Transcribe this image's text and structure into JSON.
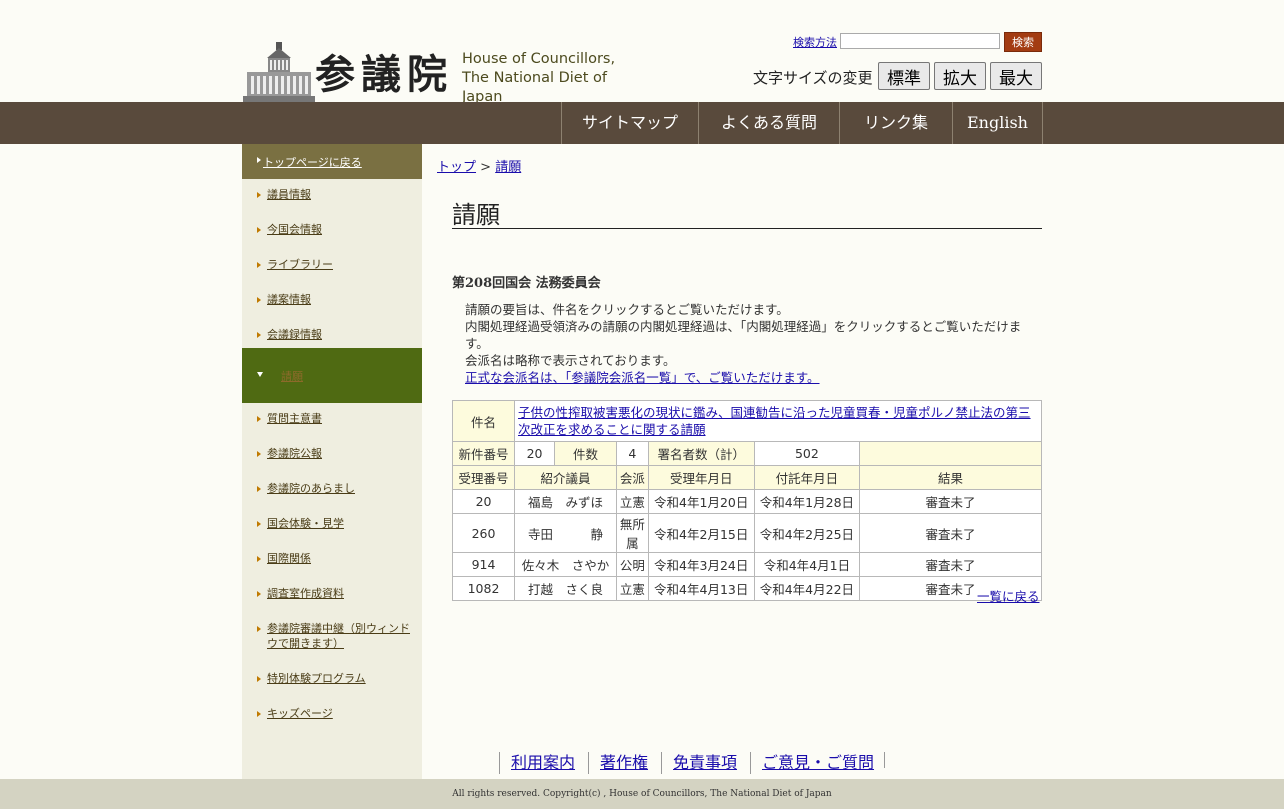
{
  "header": {
    "logo_kanji": "参議院",
    "logo_en_line1": "House of Councillors,",
    "logo_en_line2": "The National Diet of Japan",
    "search_help": "検索方法",
    "search_value": "",
    "search_button": "検索",
    "fontsize_label": "文字サイズの変更",
    "fontsize_buttons": [
      "標準",
      "拡大",
      "最大"
    ]
  },
  "nav": {
    "items": [
      "サイトマップ",
      "よくある質問",
      "リンク集",
      "English"
    ]
  },
  "sidebar": {
    "top": "トップページに戻る",
    "items": [
      "議員情報",
      "今国会情報",
      "ライブラリー",
      "議案情報",
      "会議録情報"
    ],
    "active": "請願",
    "items_after": [
      "質問主意書",
      "参議院公報",
      "参議院のあらまし",
      "国会体験・見学",
      "国際関係",
      "調査室作成資料",
      "参議院審議中継（別ウィンドウで開きます）",
      "特別体験プログラム",
      "キッズページ"
    ]
  },
  "breadcrumb": {
    "home": "トップ",
    "separator": " > ",
    "current": "請願"
  },
  "page_title": "請願",
  "session": "第208回国会 法務委員会",
  "notes": {
    "line1": "請願の要旨は、件名をクリックするとご覧いただけます。",
    "line2": "内閣処理経過受領済みの請願の内閣処理経過は、「内閣処理経過」をクリックするとご覧いただけます。",
    "line3": "会派名は略称で表示されております。",
    "link": "正式な会派名は、「参議院会派名一覧」で、ご覧いただけます。"
  },
  "petition": {
    "subject_label": "件名",
    "subject": "子供の性搾取被害悪化の現状に鑑み、国連勧告に沿った児童買春・児童ポルノ禁止法の第三次改正を求めることに関する請願",
    "new_number_label": "新件番号",
    "new_number": "20",
    "count_label": "件数",
    "count": "4",
    "signatures_label": "署名者数（計）",
    "signatures": "502",
    "columns": [
      "受理番号",
      "紹介議員",
      "会派",
      "受理年月日",
      "付託年月日",
      "結果"
    ],
    "rows": [
      [
        "20",
        "福島　みずほ",
        "立憲",
        "令和4年1月20日",
        "令和4年1月28日",
        "審査未了"
      ],
      [
        "260",
        "寺田　　　静",
        "無所属",
        "令和4年2月15日",
        "令和4年2月25日",
        "審査未了"
      ],
      [
        "914",
        "佐々木　さやか",
        "公明",
        "令和4年3月24日",
        "令和4年4月1日",
        "審査未了"
      ],
      [
        "1082",
        "打越　さく良",
        "立憲",
        "令和4年4月13日",
        "令和4年4月22日",
        "審査未了"
      ]
    ]
  },
  "back_link": "一覧に戻る",
  "footer": {
    "links": [
      "利用案内",
      "著作権",
      "免責事項",
      "ご意見・ご質問"
    ],
    "copyright": "All rights reserved. Copyright(c) , House of Councillors, The National Diet of Japan"
  },
  "colors": {
    "nav_bg": "#594a3c",
    "sidebar_bg": "#efeee0",
    "sidebar_top_bg": "#7a7042",
    "sidebar_active_bg": "#4f6a12",
    "search_button_bg": "#a33c12",
    "table_header_bg": "#fdfbdd",
    "footer_bg": "#d4d3c2"
  }
}
